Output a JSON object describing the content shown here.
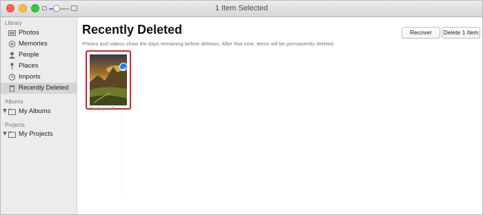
{
  "window": {
    "title": "1 Item Selected",
    "zoom_level": 0.3
  },
  "sidebar": {
    "sections": [
      {
        "title": "Library",
        "items": [
          {
            "label": "Photos",
            "icon": "photos-icon"
          },
          {
            "label": "Memories",
            "icon": "memories-icon"
          },
          {
            "label": "People",
            "icon": "people-icon"
          },
          {
            "label": "Places",
            "icon": "places-pin-icon"
          },
          {
            "label": "Imports",
            "icon": "imports-clock-icon"
          },
          {
            "label": "Recently Deleted",
            "icon": "trash-icon",
            "selected": true
          }
        ]
      },
      {
        "title": "Albums",
        "items": [
          {
            "label": "My Albums",
            "icon": "folder-icon",
            "expandable": true
          }
        ]
      },
      {
        "title": "Projects",
        "items": [
          {
            "label": "My Projects",
            "icon": "folder-icon",
            "expandable": true
          }
        ]
      }
    ]
  },
  "main": {
    "title": "Recently Deleted",
    "recover_label": "Recover",
    "delete_label": "Delete 1 Item",
    "notice": "Photos and videos show the days remaining before deletion. After that time, items will be permanently deleted.",
    "items": [
      {
        "caption": "29 days left",
        "selected": true,
        "image": "landscape-photo"
      }
    ]
  },
  "colors": {
    "selection_outline": "#d4202a",
    "check_badge": "#1e7cf2",
    "sidebar_selected": "#d5d5d5"
  }
}
